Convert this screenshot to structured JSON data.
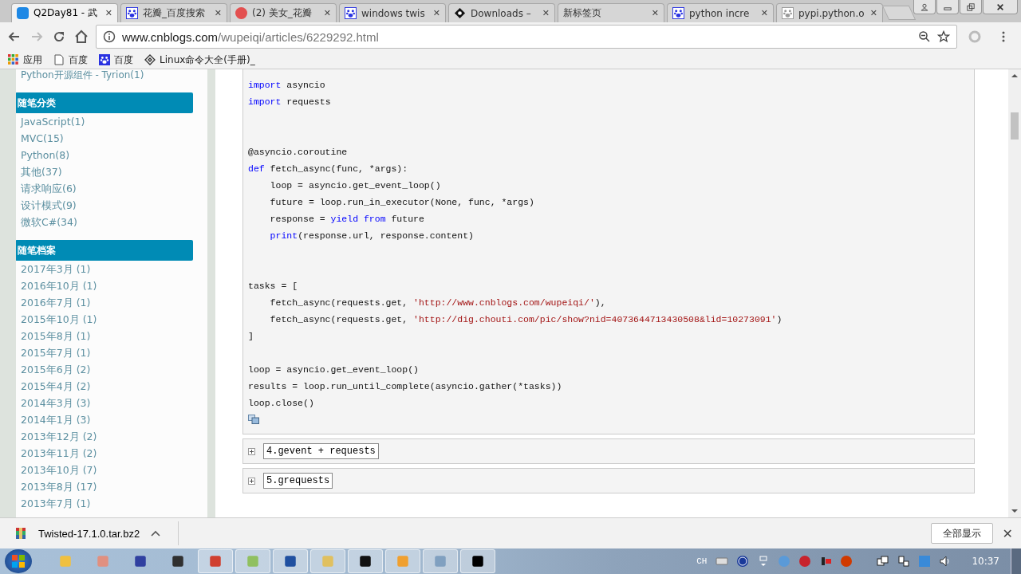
{
  "tabs": [
    {
      "title": "Q2Day81 - 武",
      "close": "✕",
      "selected": true
    },
    {
      "title": "花瓣_百度搜索",
      "close": "✕",
      "selected": false
    },
    {
      "title": "(2) 美女_花瓣",
      "close": "✕",
      "selected": false
    },
    {
      "title": "windows twis",
      "close": "✕",
      "selected": false
    },
    {
      "title": "Downloads –",
      "close": "✕",
      "selected": false
    },
    {
      "title": "新标签页",
      "close": "✕",
      "selected": false
    },
    {
      "title": "python incre",
      "close": "✕",
      "selected": false
    },
    {
      "title": "pypi.python.o",
      "close": "✕",
      "selected": false
    }
  ],
  "address_bar": {
    "host": "www.cnblogs.com",
    "path": "/wupeiqi/articles/6229292.html"
  },
  "bookmarks": [
    {
      "label": "应用"
    },
    {
      "label": "百度"
    },
    {
      "label": "百度"
    },
    {
      "label": "Linux命令大全(手册)_"
    }
  ],
  "sidebar": {
    "top_item": "Python开源组件 - Tyrion(1)",
    "sections": [
      {
        "title": "随笔分类",
        "items": [
          "JavaScript(1)",
          "MVC(15)",
          "Python(8)",
          "其他(37)",
          "请求响应(6)",
          "设计模式(9)",
          "微软C#(34)"
        ]
      },
      {
        "title": "随笔档案",
        "items": [
          "2017年3月 (1)",
          "2016年10月 (1)",
          "2016年7月 (1)",
          "2015年10月 (1)",
          "2015年8月 (1)",
          "2015年7月 (1)",
          "2015年6月 (2)",
          "2015年4月 (2)",
          "2014年3月 (3)",
          "2014年1月 (3)",
          "2013年12月 (2)",
          "2013年11月 (2)",
          "2013年10月 (7)",
          "2013年8月 (17)",
          "2013年7月 (1)"
        ]
      }
    ]
  },
  "code": [
    {
      "kind": "code",
      "segments": [
        {
          "kind": "kw",
          "text": "import"
        },
        {
          "kind": "plain",
          "text": " asyncio"
        }
      ]
    },
    {
      "kind": "code",
      "segments": [
        {
          "kind": "kw",
          "text": "import"
        },
        {
          "kind": "plain",
          "text": " requests"
        }
      ]
    },
    {
      "kind": "blank"
    },
    {
      "kind": "blank"
    },
    {
      "kind": "code",
      "segments": [
        {
          "kind": "plain",
          "text": "@asyncio.coroutine"
        }
      ]
    },
    {
      "kind": "code",
      "segments": [
        {
          "kind": "kw",
          "text": "def"
        },
        {
          "kind": "plain",
          "text": " fetch_async(func, *args):"
        }
      ]
    },
    {
      "kind": "code",
      "segments": [
        {
          "kind": "plain",
          "text": "    loop = asyncio.get_event_loop()"
        }
      ]
    },
    {
      "kind": "code",
      "segments": [
        {
          "kind": "plain",
          "text": "    future = loop.run_in_executor(None, func, *args)"
        }
      ]
    },
    {
      "kind": "code",
      "segments": [
        {
          "kind": "plain",
          "text": "    response = "
        },
        {
          "kind": "kw",
          "text": "yield from"
        },
        {
          "kind": "plain",
          "text": " future"
        }
      ]
    },
    {
      "kind": "code",
      "segments": [
        {
          "kind": "kw",
          "text": "    print"
        },
        {
          "kind": "plain",
          "text": "(response.url, response.content)"
        }
      ]
    },
    {
      "kind": "blank"
    },
    {
      "kind": "blank"
    },
    {
      "kind": "code",
      "segments": [
        {
          "kind": "plain",
          "text": "tasks = ["
        }
      ]
    },
    {
      "kind": "code",
      "segments": [
        {
          "kind": "plain",
          "text": "    fetch_async(requests.get, "
        },
        {
          "kind": "str",
          "text": "'http://www.cnblogs.com/wupeiqi/'"
        },
        {
          "kind": "plain",
          "text": "),"
        }
      ]
    },
    {
      "kind": "code",
      "segments": [
        {
          "kind": "plain",
          "text": "    fetch_async(requests.get, "
        },
        {
          "kind": "str",
          "text": "'http://dig.chouti.com/pic/show?nid=4073644713430508&lid=10273091'"
        },
        {
          "kind": "plain",
          "text": ")"
        }
      ]
    },
    {
      "kind": "code",
      "segments": [
        {
          "kind": "plain",
          "text": "]"
        }
      ]
    },
    {
      "kind": "blank"
    },
    {
      "kind": "code",
      "segments": [
        {
          "kind": "plain",
          "text": "loop = asyncio.get_event_loop()"
        }
      ]
    },
    {
      "kind": "code",
      "segments": [
        {
          "kind": "plain",
          "text": "results = loop.run_until_complete(asyncio.gather(*tasks))"
        }
      ]
    },
    {
      "kind": "code",
      "segments": [
        {
          "kind": "plain",
          "text": "loop.close()"
        }
      ]
    }
  ],
  "sections": [
    {
      "title": "4.gevent + requests",
      "expanded": false
    },
    {
      "title": "5.grequests",
      "expanded": false
    }
  ],
  "download": {
    "filename": "Twisted-17.1.0.tar.bz2",
    "show_all": "全部显示",
    "close": "✕"
  },
  "taskbar": {
    "language": "CH",
    "time": "10:37"
  }
}
